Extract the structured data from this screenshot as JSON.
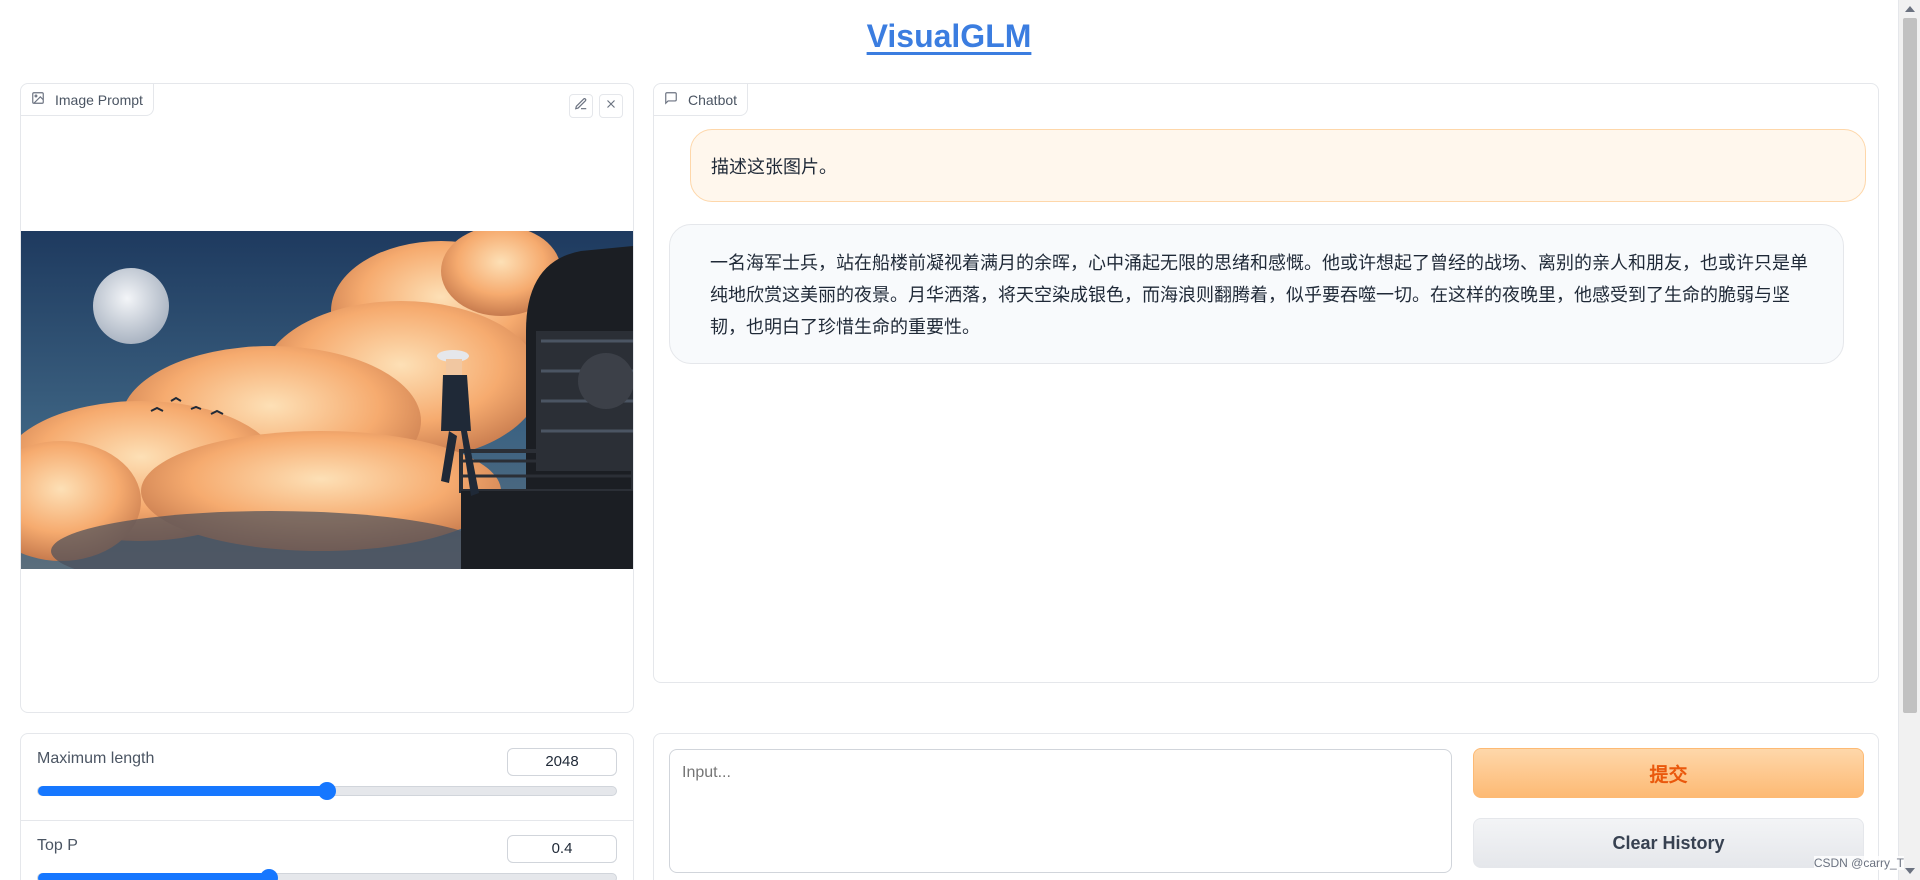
{
  "app": {
    "title": "VisualGLM"
  },
  "image_prompt": {
    "label": "Image Prompt",
    "icon": "image-icon",
    "tools": [
      "edit-icon",
      "close-icon"
    ]
  },
  "chatbot": {
    "label": "Chatbot",
    "icon": "chat-icon",
    "messages": [
      {
        "role": "user",
        "text": "描述这张图片。"
      },
      {
        "role": "bot",
        "text": "一名海军士兵，站在船楼前凝视着满月的余晖，心中涌起无限的思绪和感慨。他或许想起了曾经的战场、离别的亲人和朋友，也或许只是单纯地欣赏这美丽的夜景。月华洒落，将天空染成银色，而海浪则翻腾着，似乎要吞噬一切。在这样的夜晚里，他感受到了生命的脆弱与坚韧，也明白了珍惜生命的重要性。"
      }
    ]
  },
  "settings": {
    "max_length": {
      "label": "Maximum length",
      "value": "2048",
      "fraction": 0.5
    },
    "top_p": {
      "label": "Top P",
      "value": "0.4",
      "fraction": 0.4
    }
  },
  "input": {
    "placeholder": "Input...",
    "submit_label": "提交",
    "clear_label": "Clear History"
  },
  "colors": {
    "accent": "#1677ff",
    "title_link": "#3b7de0",
    "user_bubble": "#fff7ed",
    "submit_text": "#ea580c"
  },
  "watermark": "CSDN @carry_T"
}
